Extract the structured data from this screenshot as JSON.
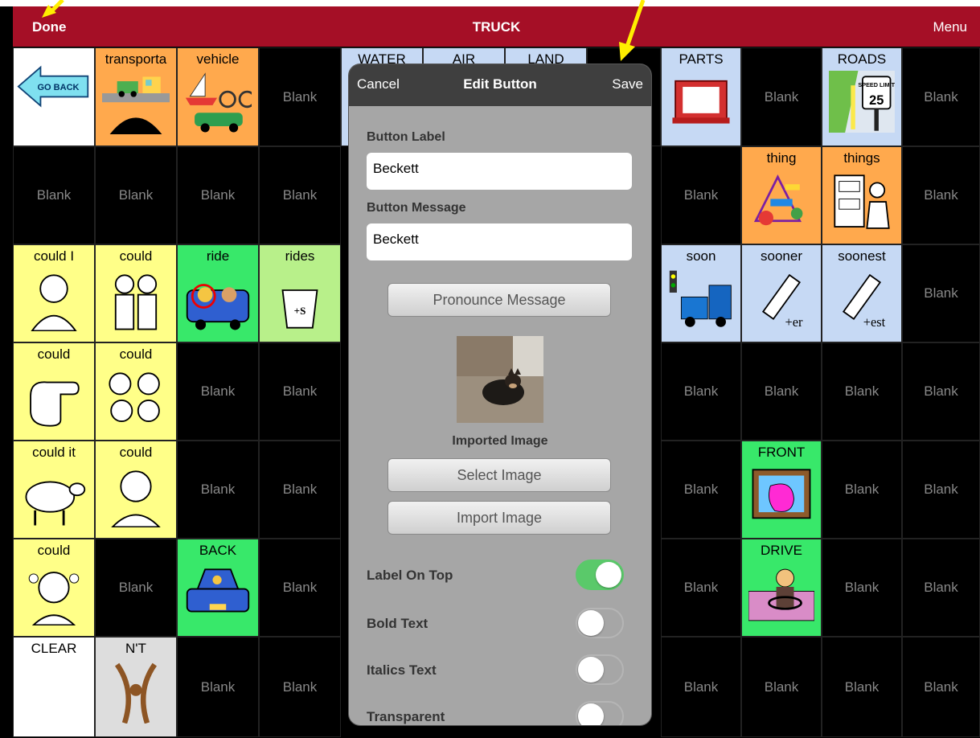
{
  "topbar": {
    "done": "Done",
    "title": "TRUCK",
    "menu": "Menu"
  },
  "blank_label": "Blank",
  "cells": {
    "r1": [
      "GO BACK",
      "transporta",
      "vehicle",
      "Blank",
      "WATER",
      "AIR",
      "LAND",
      "PARTS",
      "Blank",
      "ROADS",
      "Blank"
    ],
    "r2": [
      "Blank",
      "Blank",
      "Blank",
      "Blank",
      "Blank",
      "thing",
      "things",
      "Blank"
    ],
    "r3": [
      "could I",
      "could",
      "ride",
      "rides",
      "soon",
      "sooner",
      "soonest",
      "Blank"
    ],
    "r4": [
      "could",
      "could",
      "Blank",
      "Blank",
      "Blank",
      "Blank",
      "Blank",
      "Blank"
    ],
    "r5": [
      "could it",
      "could",
      "Blank",
      "Blank",
      "Blank",
      "FRONT",
      "Blank",
      "Blank"
    ],
    "r6": [
      "could",
      "Blank",
      "BACK",
      "Blank",
      "Blank",
      "DRIVE",
      "Blank",
      "Blank"
    ],
    "r7": [
      "CLEAR",
      "N'T",
      "Blank",
      "Blank",
      "Blank",
      "Blank",
      "Blank",
      "Blank"
    ]
  },
  "pictogram_text": {
    "speed_limit": "SPEED LIMIT",
    "speed_value": "25",
    "plus_s": "+S",
    "plus_er": "+er",
    "plus_est": "+est"
  },
  "dialog": {
    "cancel": "Cancel",
    "title": "Edit Button",
    "save": "Save",
    "label_caption": "Button Label",
    "label_value": "Beckett",
    "message_caption": "Button Message",
    "message_value": "Beckett",
    "pronounce": "Pronounce Message",
    "image_caption": "Imported Image",
    "select_image": "Select Image",
    "import_image": "Import Image",
    "toggles": [
      {
        "label": "Label On Top",
        "on": true
      },
      {
        "label": "Bold Text",
        "on": false
      },
      {
        "label": "Italics Text",
        "on": false
      },
      {
        "label": "Transparent",
        "on": false
      }
    ]
  },
  "colors": {
    "topbar": "#a50f26",
    "dialog_bg": "#a6a6a6",
    "dialog_header": "#3f3f3f",
    "toggle_on": "#5ac96a",
    "arrow": "#ffee00"
  }
}
